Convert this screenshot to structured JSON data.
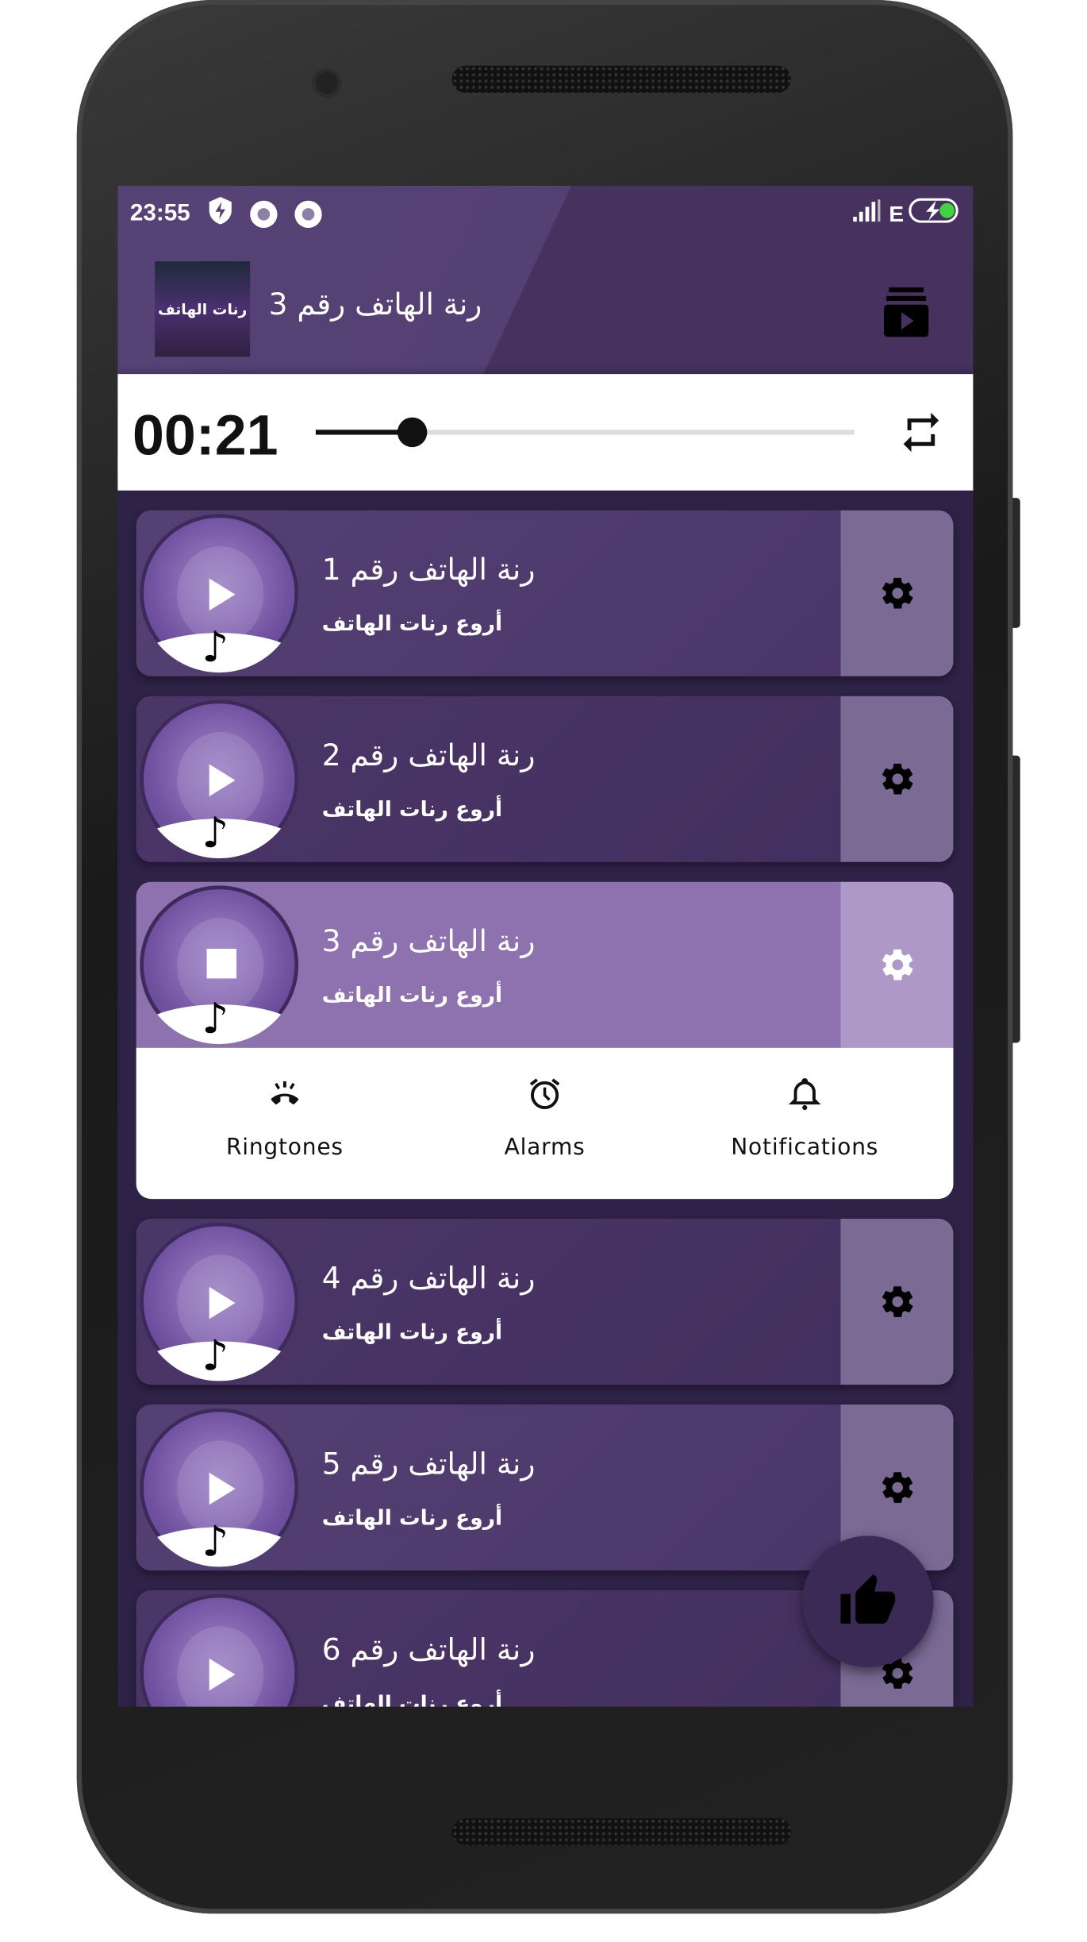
{
  "status_bar": {
    "time": "23:55",
    "network": "E",
    "icons": [
      "shield-bolt-icon",
      "record-icon",
      "record-icon",
      "signal-icon",
      "battery-charging-icon"
    ]
  },
  "app_bar": {
    "title": "رنة الهاتف رقم 3",
    "thumbnail_text": "رنات الهاتف",
    "action_icon": "queue-play-icon"
  },
  "player": {
    "elapsed": "00:21",
    "progress_percent": 18,
    "repeat_icon": "repeat-icon"
  },
  "ringtones": [
    {
      "title": "رنة الهاتف رقم 1",
      "subtitle": "أروع رنات الهاتف",
      "state": "play"
    },
    {
      "title": "رنة الهاتف رقم 2",
      "subtitle": "أروع رنات الهاتف",
      "state": "play"
    },
    {
      "title": "رنة الهاتف رقم 3",
      "subtitle": "أروع رنات الهاتف",
      "state": "stop"
    },
    {
      "title": "رنة الهاتف رقم 4",
      "subtitle": "أروع رنات الهاتف",
      "state": "play"
    },
    {
      "title": "رنة الهاتف رقم 5",
      "subtitle": "أروع رنات الهاتف",
      "state": "play"
    },
    {
      "title": "رنة الهاتف رقم 6",
      "subtitle": "أروع رنات الهاتف",
      "state": "play"
    }
  ],
  "set_as_options": [
    {
      "label": "Ringtones",
      "icon": "ringing-phone-icon"
    },
    {
      "label": "Alarms",
      "icon": "alarm-clock-icon"
    },
    {
      "label": "Notifications",
      "icon": "bell-icon"
    }
  ],
  "fab": {
    "icon": "thumbs-up-icon"
  },
  "colors": {
    "app_bar": "#46315f",
    "list_bg": "#2e2246",
    "card": "#4a3668",
    "card_active": "#8e72b0",
    "gear_panel": "#7a6a94",
    "gear_panel_active": "#ae98c8",
    "fab": "#3a2a55"
  }
}
